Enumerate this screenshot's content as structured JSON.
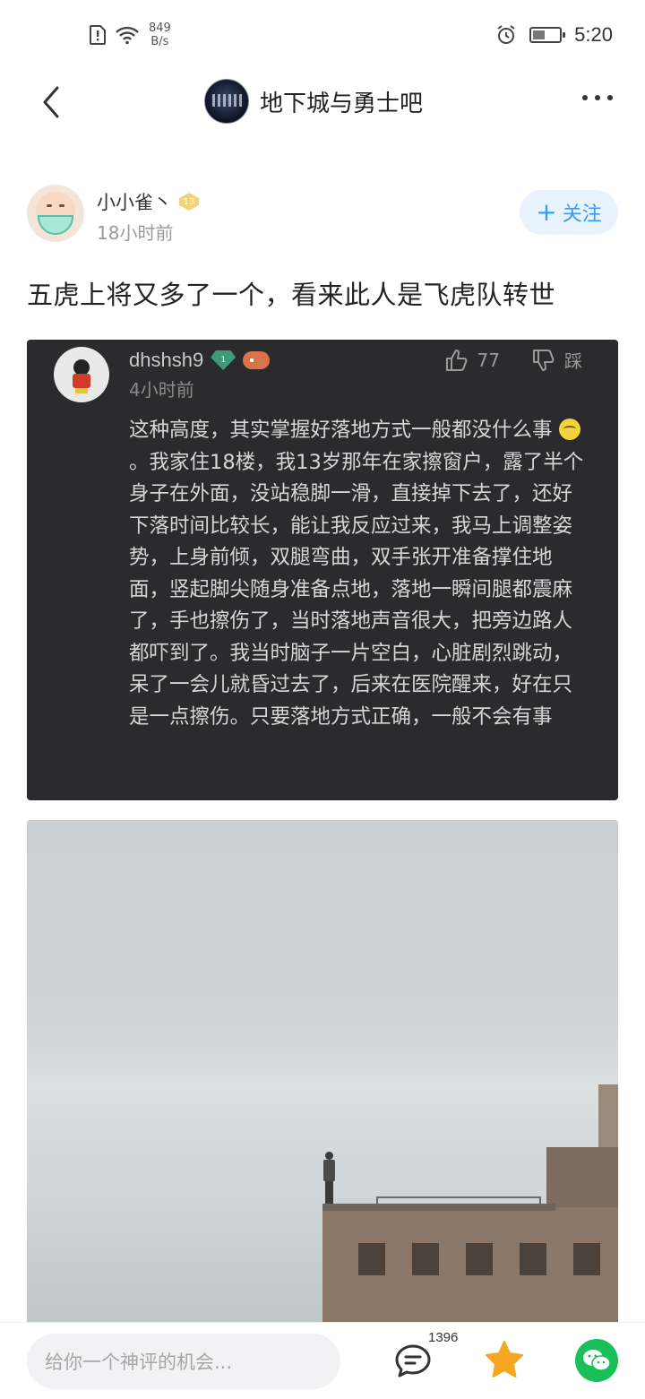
{
  "status_bar": {
    "net_speed_value": "849",
    "net_speed_unit": "B/s",
    "time": "5:20",
    "battery_level": 0.45
  },
  "nav": {
    "forum_name": "地下城与勇士吧"
  },
  "post": {
    "author": {
      "name": "小小雀丶",
      "level": "13",
      "time": "18小时前"
    },
    "follow_label": "关注",
    "title": "五虎上将又多了一个，看来此人是飞虎队转世"
  },
  "embedded_comment": {
    "user": "dhshsh9",
    "badge_level": "1",
    "time": "4小时前",
    "likes": "77",
    "dislike_label": "踩",
    "text_part1": "这种高度，其实掌握好落地方式一般都没什么事",
    "text_part2": "。我家住18楼，我13岁那年在家擦窗户，露了半个身子在外面，没站稳脚一滑，直接掉下去了，还好下落时间比较长，能让我反应过来，我马上调整姿势，上身前倾，双腿弯曲，双手张开准备撑住地面，竖起脚尖随身准备点地，落地一瞬间腿都震麻了，手也擦伤了，当时落地声音很大，把旁边路人都吓到了。我当时脑子一片空白，心脏剧烈跳动，呆了一会儿就昏过去了，后来在医院醒来，好在只是一点擦伤。只要落地方式正确，一般不会有事"
  },
  "bottom_bar": {
    "comment_placeholder": "给你一个神评的机会...",
    "reply_count": "1396"
  },
  "icons": {
    "back": "chevron-left-icon",
    "more": "more-dots-icon",
    "reply": "comment-bubble-icon",
    "favorite": "star-icon",
    "share": "wechat-icon"
  },
  "colors": {
    "accent_blue": "#3a9cf0",
    "star_orange": "#f5a623",
    "wechat_green": "#19c05a",
    "dark_card": "#2b2b2d"
  }
}
